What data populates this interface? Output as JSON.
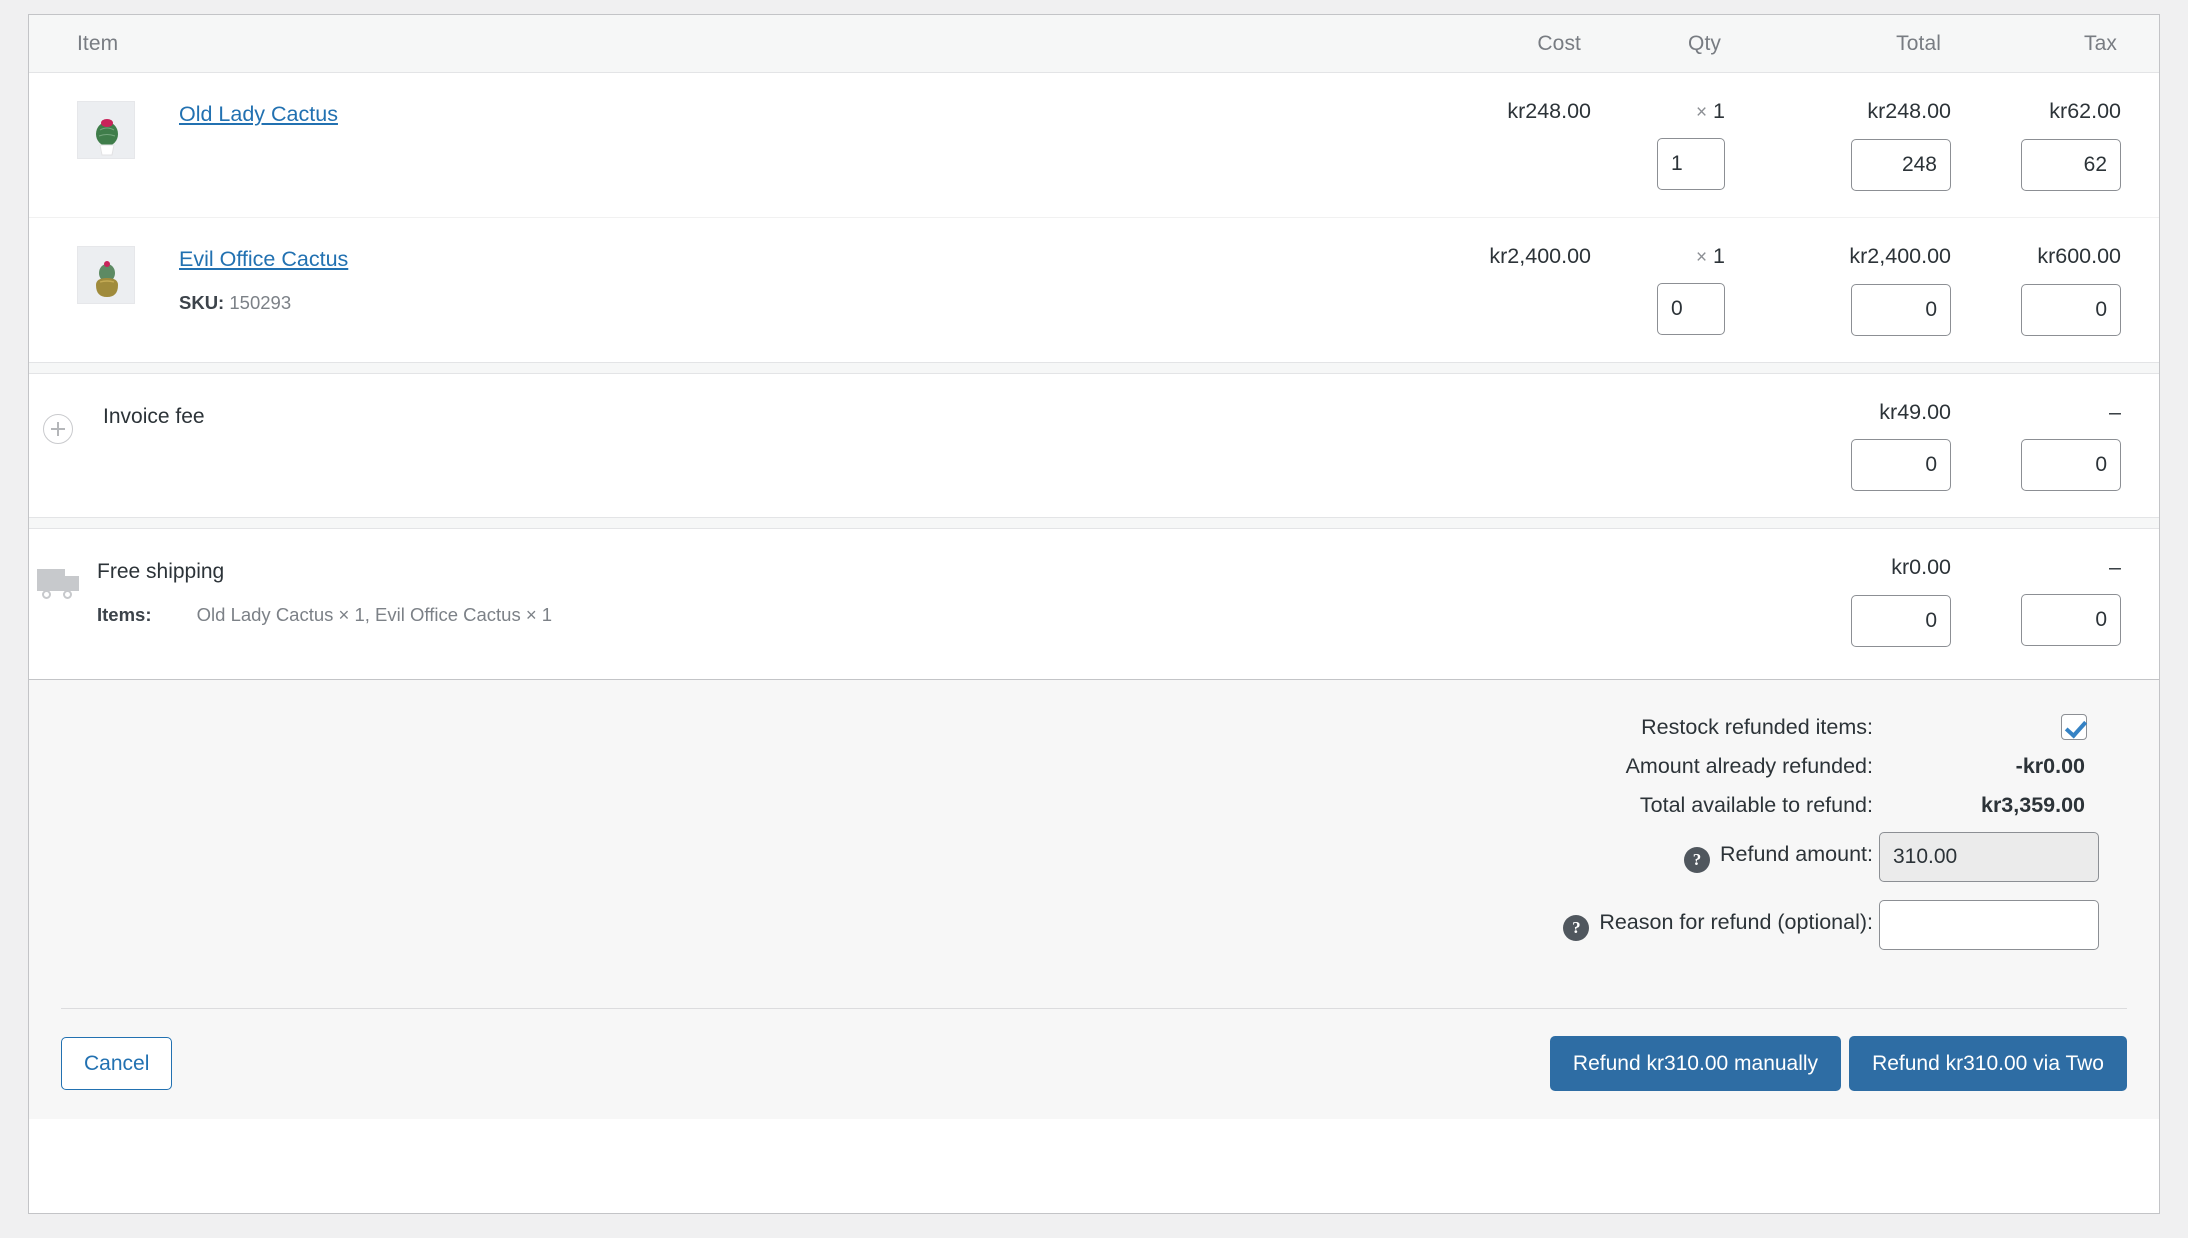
{
  "table": {
    "columns": {
      "item": "Item",
      "cost": "Cost",
      "qty": "Qty",
      "total": "Total",
      "tax": "Tax"
    }
  },
  "line_items": [
    {
      "name": "Old Lady Cactus",
      "sku_label": "",
      "sku_value": "",
      "cost": "kr248.00",
      "qty_symbol": "×",
      "qty": "1",
      "total": "kr248.00",
      "tax": "kr62.00",
      "refund_qty": "1",
      "refund_total": "248",
      "refund_tax": "62"
    },
    {
      "name": "Evil Office Cactus",
      "sku_label": "SKU:",
      "sku_value": "150293",
      "cost": "kr2,400.00",
      "qty_symbol": "×",
      "qty": "1",
      "total": "kr2,400.00",
      "tax": "kr600.00",
      "refund_qty": "0",
      "refund_total": "0",
      "refund_tax": "0"
    }
  ],
  "fee": {
    "name": "Invoice fee",
    "total": "kr49.00",
    "tax": "–",
    "refund_total": "0",
    "refund_tax": "0"
  },
  "shipping": {
    "name": "Free shipping",
    "items_label": "Items:",
    "items_value": "Old Lady Cactus × 1, Evil Office Cactus × 1",
    "total": "kr0.00",
    "tax": "–",
    "refund_total": "0",
    "refund_tax": "0"
  },
  "refund": {
    "restock_label": "Restock refunded items:",
    "restock_checked": true,
    "already_refunded_label": "Amount already refunded:",
    "already_refunded_value": "-kr0.00",
    "available_label": "Total available to refund:",
    "available_value": "kr3,359.00",
    "amount_label": "Refund amount:",
    "amount_value": "310.00",
    "reason_label": "Reason for refund (optional):",
    "reason_value": "",
    "help_glyph": "?"
  },
  "actions": {
    "cancel": "Cancel",
    "refund_manually": "Refund kr310.00 manually",
    "refund_via_gateway": "Refund kr310.00 via Two"
  },
  "colors": {
    "link": "#2271b1",
    "primary_button": "#2e6da4",
    "checkbox_check": "#3582c4"
  }
}
